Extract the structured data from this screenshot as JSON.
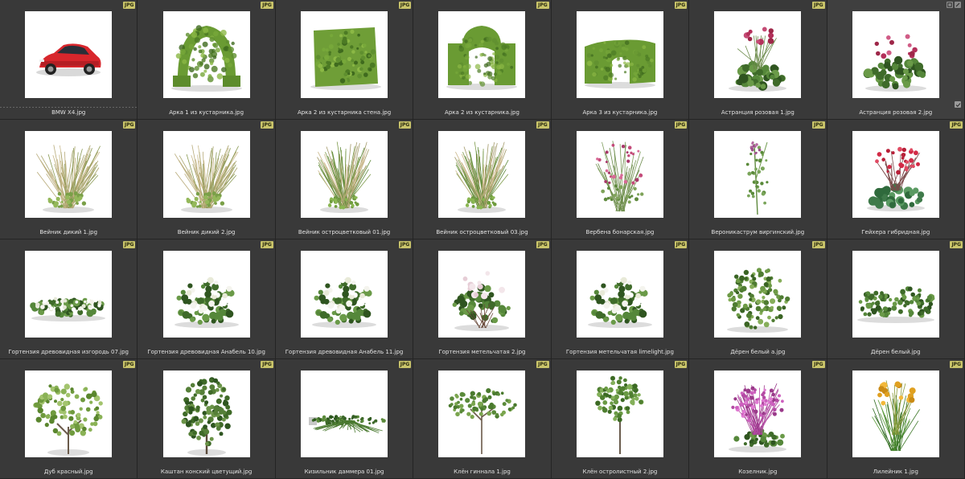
{
  "badge": "JPG",
  "files": [
    {
      "name": "BMW X4.jpg",
      "kind": "car"
    },
    {
      "name": "Арка 1 из кустарника.jpg",
      "kind": "arch1"
    },
    {
      "name": "Арка 2 из кустарника стена.jpg",
      "kind": "wall"
    },
    {
      "name": "Арка 2 из кустарника.jpg",
      "kind": "arch2"
    },
    {
      "name": "Арка 3 из кустарника.jpg",
      "kind": "arch3"
    },
    {
      "name": "Астранция розовая 1.jpg",
      "kind": "astrantia"
    },
    {
      "name": "Астранция розовая 2.jpg",
      "kind": "astrantia2"
    },
    {
      "name": "Вейник дикий 1.jpg",
      "kind": "grass"
    },
    {
      "name": "Вейник дикий 2.jpg",
      "kind": "grass"
    },
    {
      "name": "Вейник остроцветковый 01.jpg",
      "kind": "grass2"
    },
    {
      "name": "Вейник остроцветковый 03.jpg",
      "kind": "grass2"
    },
    {
      "name": "Вербена бонарская.jpg",
      "kind": "verbena"
    },
    {
      "name": "Вероникаструм виргинский.jpg",
      "kind": "veronica"
    },
    {
      "name": "Гейхера гибридная.jpg",
      "kind": "heuchera"
    },
    {
      "name": "Гортензия древовидная изгородь 07.jpg",
      "kind": "hedgeflower"
    },
    {
      "name": "Гортензия древовидная Анабель 10.jpg",
      "kind": "hydrangea"
    },
    {
      "name": "Гортензия древовидная Анабель 11.jpg",
      "kind": "hydrangea"
    },
    {
      "name": "Гортензия метельчатая 2.jpg",
      "kind": "panicle"
    },
    {
      "name": "Гортензия метельчатая limelight.jpg",
      "kind": "hydrangea"
    },
    {
      "name": "Дёрен белый а.jpg",
      "kind": "dogwood"
    },
    {
      "name": "Дёрен белый.jpg",
      "kind": "dogwoodrow"
    },
    {
      "name": "Дуб красный.jpg",
      "kind": "oak"
    },
    {
      "name": "Каштан конский цветущий.jpg",
      "kind": "chestnut"
    },
    {
      "name": "Кизильник даммера 01.jpg",
      "kind": "ground"
    },
    {
      "name": "Клён гиннала 1.jpg",
      "kind": "maple"
    },
    {
      "name": "Клён остролистный 2.jpg",
      "kind": "maple2"
    },
    {
      "name": "Козелник.jpg",
      "kind": "purple"
    },
    {
      "name": "Лилейник 1.jpg",
      "kind": "daylily"
    }
  ],
  "colors": {
    "background": "#2b2b2b",
    "cell": "#393939",
    "badge": "#c9c46a",
    "label": "#e2e2e2"
  }
}
